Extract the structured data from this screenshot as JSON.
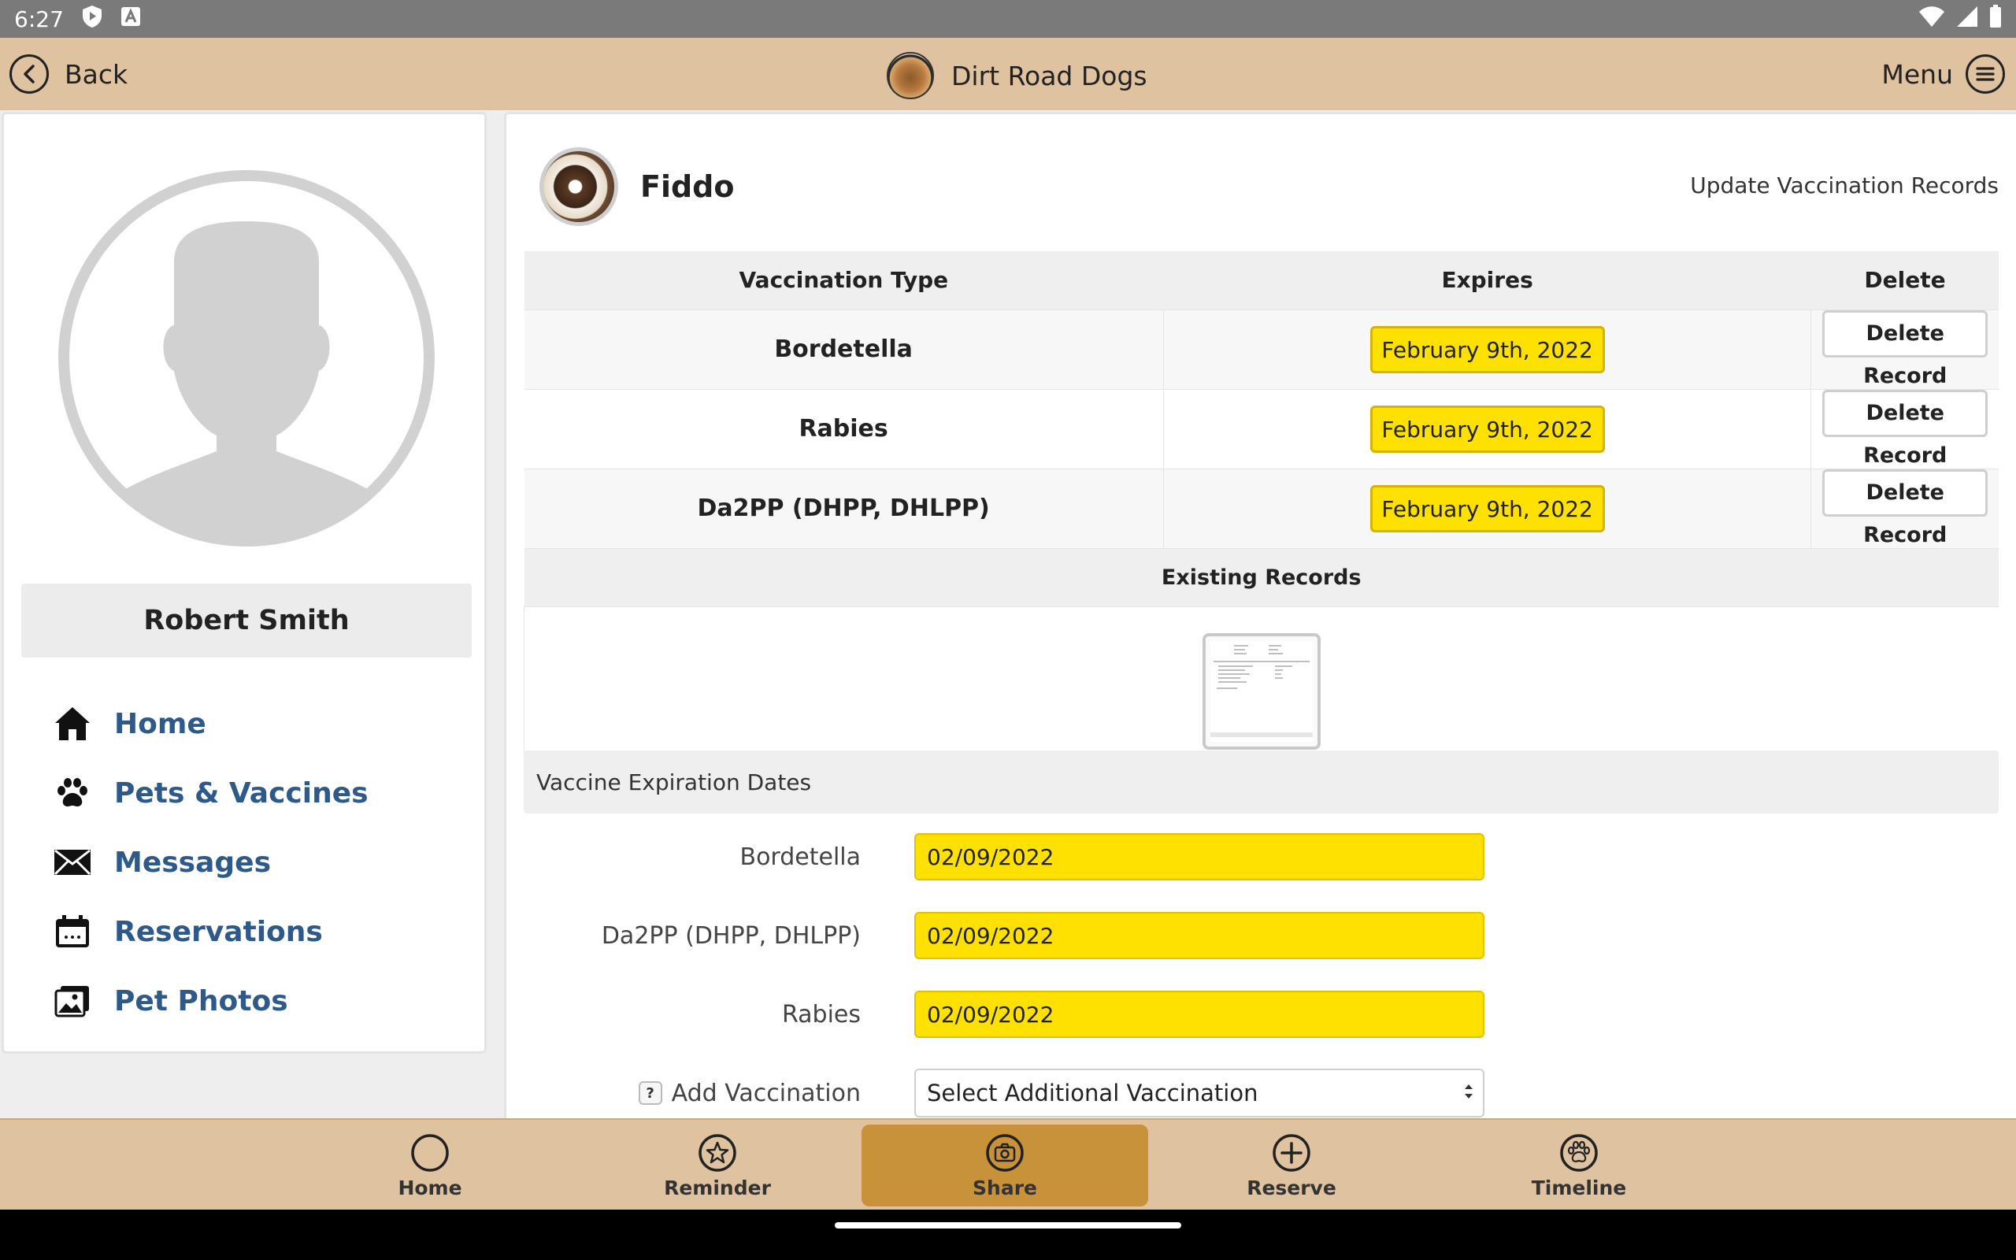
{
  "status_bar": {
    "time": "6:27"
  },
  "top_bar": {
    "back_label": "Back",
    "title": "Dirt Road Dogs",
    "menu_label": "Menu"
  },
  "sidebar": {
    "user_name": "Robert Smith",
    "nav": [
      {
        "label": "Home",
        "icon": "home-icon"
      },
      {
        "label": "Pets & Vaccines",
        "icon": "paw-icon"
      },
      {
        "label": "Messages",
        "icon": "envelope-icon"
      },
      {
        "label": "Reservations",
        "icon": "calendar-icon"
      },
      {
        "label": "Pet Photos",
        "icon": "photos-icon"
      }
    ]
  },
  "pet": {
    "name": "Fiddo",
    "update_link": "Update Vaccination Records"
  },
  "table": {
    "headers": {
      "type": "Vaccination Type",
      "expires": "Expires",
      "delete": "Delete"
    },
    "rows": [
      {
        "type": "Bordetella",
        "expires": "February 9th, 2022",
        "action": "Delete Record"
      },
      {
        "type": "Rabies",
        "expires": "February 9th, 2022",
        "action": "Delete Record"
      },
      {
        "type": "Da2PP (DHPP, DHLPP)",
        "expires": "February 9th, 2022",
        "action": "Delete Record"
      }
    ],
    "existing_records_label": "Existing Records"
  },
  "form": {
    "section_title": "Vaccine Expiration Dates",
    "fields": [
      {
        "label": "Bordetella",
        "value": "02/09/2022"
      },
      {
        "label": "Da2PP (DHPP, DHLPP)",
        "value": "02/09/2022"
      },
      {
        "label": "Rabies",
        "value": "02/09/2022"
      }
    ],
    "add_vaccination": {
      "help": "?",
      "label": "Add Vaccination",
      "selected": "Select Additional Vaccination"
    }
  },
  "bottom_tabs": [
    {
      "label": "Home",
      "icon": "circle-icon"
    },
    {
      "label": "Reminder",
      "icon": "star-icon"
    },
    {
      "label": "Share",
      "icon": "camera-icon",
      "active": true
    },
    {
      "label": "Reserve",
      "icon": "plus-circle-icon"
    },
    {
      "label": "Timeline",
      "icon": "paw-circle-icon"
    }
  ],
  "colors": {
    "header_bg": "#dfc29f",
    "accent_yellow": "#ffe100",
    "active_tab": "#c8923a",
    "nav_link": "#2d5a8a"
  }
}
